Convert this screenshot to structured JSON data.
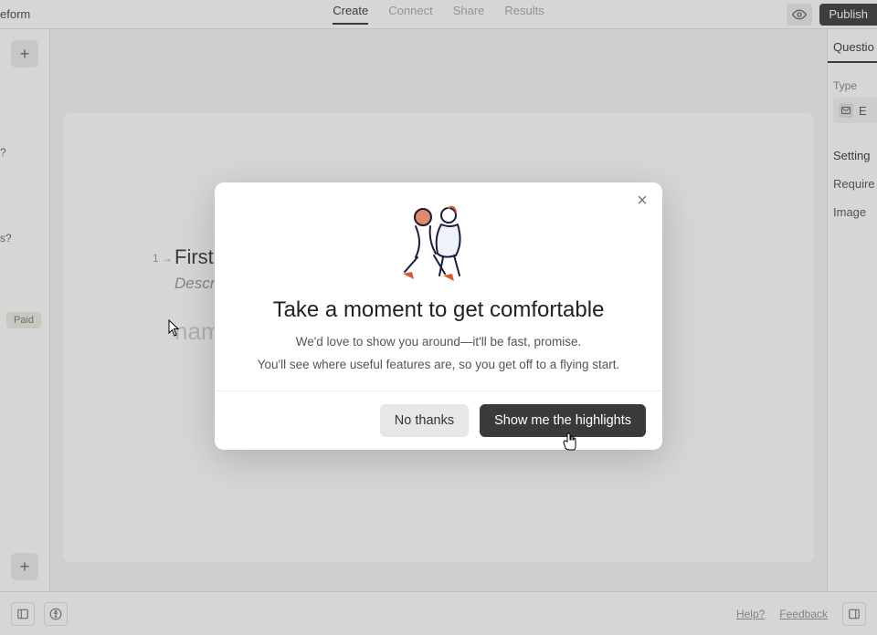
{
  "brand": "eform",
  "topTabs": {
    "create": "Create",
    "connect": "Connect",
    "share": "Share",
    "results": "Results"
  },
  "publishLabel": "Publish",
  "leftRail": {
    "fragment1": "?",
    "fragment2": "s?",
    "paidBadge": "Paid"
  },
  "question": {
    "index": "1 →",
    "titleFragment": "First ",
    "descFragment": "Descr",
    "inputFragment": "nam"
  },
  "rightPanel": {
    "tab": "Questio",
    "typeLabel": "Type",
    "fieldTypeLetter": "E",
    "settingsLabel": "Setting",
    "requiredLabel": "Require",
    "imageLabel": "Image "
  },
  "bottom": {
    "help": "Help?",
    "feedback": "Feedback"
  },
  "modal": {
    "title": "Take a moment to get comfortable",
    "body1": "We'd love to show you around—it'll be fast, promise.",
    "body2": "You'll see where useful features are, so you get off to a flying start.",
    "secondary": "No thanks",
    "primary": "Show me the highlights"
  }
}
